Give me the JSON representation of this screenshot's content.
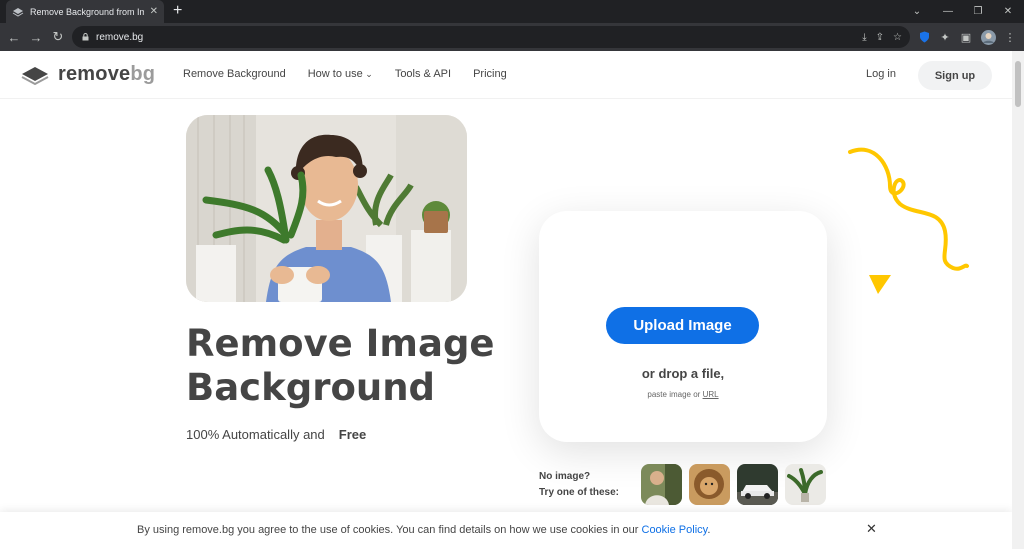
{
  "browser": {
    "tab_title": "Remove Background from Image",
    "tab_close": "✕",
    "new_tab": "+",
    "url": "remove.bg"
  },
  "site": {
    "logo_main": "remove",
    "logo_bg": "bg",
    "nav": [
      "Remove Background",
      "How to use",
      "Tools & API",
      "Pricing"
    ],
    "login": "Log in",
    "signup": "Sign up"
  },
  "hero": {
    "headline_line1": "Remove Image",
    "headline_line2": "Background",
    "subline": "100% Automatically and",
    "free": "Free"
  },
  "upload": {
    "button": "Upload Image",
    "drop": "or drop a file,",
    "paste_prefix": "paste image or",
    "paste_link": "URL"
  },
  "samples": {
    "line1": "No image?",
    "line2": "Try one of these:"
  },
  "cookie": {
    "text": "By using remove.bg you agree to the use of cookies. You can find details on how we use cookies in our",
    "link": "Cookie Policy",
    "suffix": ".",
    "close": "✕"
  },
  "colors": {
    "accent_blue": "#0f70e6",
    "accent_yellow": "#ffc700",
    "text_dark": "#454545"
  }
}
